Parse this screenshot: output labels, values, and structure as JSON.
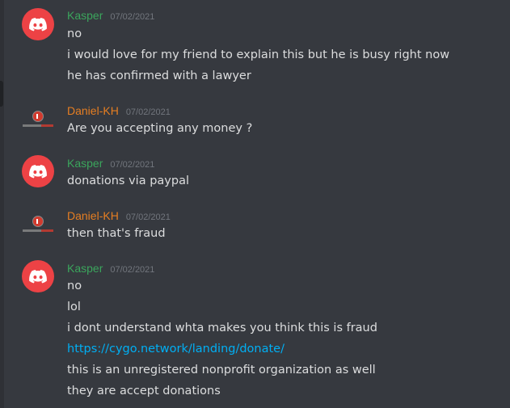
{
  "colors": {
    "background": "#36393f",
    "kasper_name": "#3ba55c",
    "daniel_name": "#e67e22",
    "text": "#dcddde",
    "link": "#00aff4",
    "timestamp": "#72767d",
    "discord_avatar": "#ed4245"
  },
  "messages": [
    {
      "author": "Kasper",
      "date": "07/02/2021",
      "avatar": "discord-logo-icon",
      "lines": [
        "no",
        "i would love for my friend to explain this but he is busy right now",
        "he has confirmed with a lawyer"
      ]
    },
    {
      "author": "Daniel-KH",
      "date": "07/02/2021",
      "avatar": "kh-logo-icon",
      "lines": [
        "Are you accepting any money ?"
      ]
    },
    {
      "author": "Kasper",
      "date": "07/02/2021",
      "avatar": "discord-logo-icon",
      "lines": [
        "donations via paypal"
      ]
    },
    {
      "author": "Daniel-KH",
      "date": "07/02/2021",
      "avatar": "kh-logo-icon",
      "lines": [
        "then that's fraud"
      ]
    },
    {
      "author": "Kasper",
      "date": "07/02/2021",
      "avatar": "discord-logo-icon",
      "lines": [
        "no",
        "lol",
        "i dont understand whta makes you think this is fraud",
        "https://cygo.network/landing/donate/",
        "this is an unregistered nonprofit organization as well",
        "they are accept donations"
      ]
    }
  ]
}
